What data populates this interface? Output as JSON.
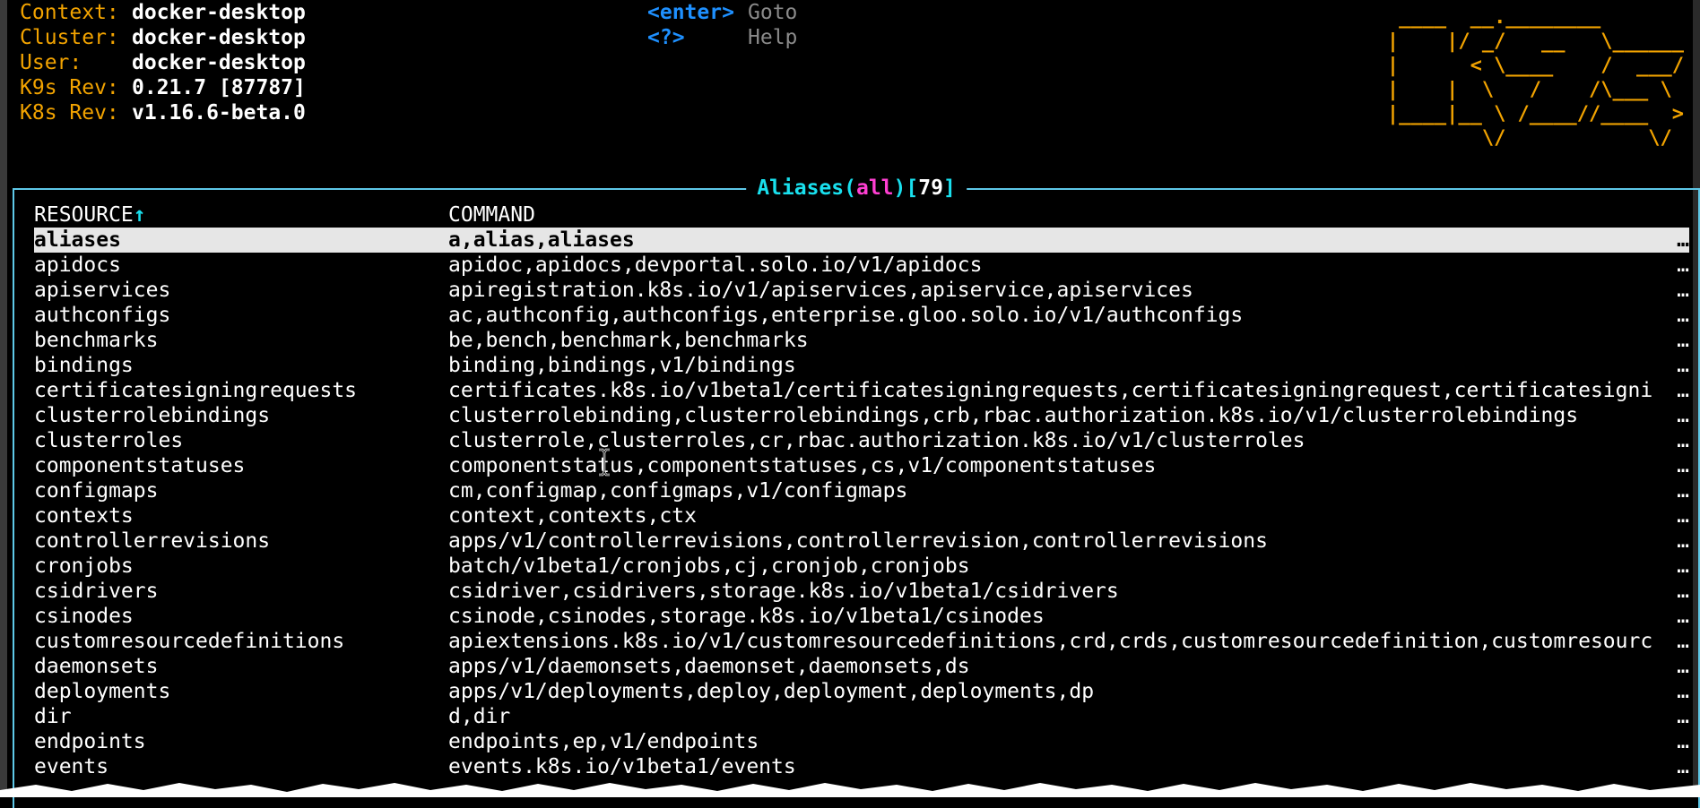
{
  "cluster_info": [
    {
      "label": "Context:",
      "value": "docker-desktop"
    },
    {
      "label": "Cluster:",
      "value": "docker-desktop"
    },
    {
      "label": "User:",
      "value": "docker-desktop"
    },
    {
      "label": "K9s Rev:",
      "value": "0.21.7 [87787]"
    },
    {
      "label": "K8s Rev:",
      "value": "v1.16.6-beta.0"
    }
  ],
  "key_hints": [
    {
      "key": "<enter>",
      "action": "Goto"
    },
    {
      "key": "<?>",
      "action": "Help"
    }
  ],
  "logo_ascii": " ____  __.________\n|    |/ _/   __   \\______\n|      < \\____    /  ___/\n|    |  \\   /    /\\___ \\\n|____|__ \\ /____//____  >\n        \\/            \\/",
  "view": {
    "title": "Aliases",
    "open_paren": "(",
    "namespace": "all",
    "close_paren": ")",
    "open_bracket": "[",
    "count": "79",
    "close_bracket": "]"
  },
  "table": {
    "columns": [
      "RESOURCE",
      "COMMAND"
    ],
    "sort_indicator": "↑",
    "ellipsis": "…",
    "rows": [
      {
        "resource": "aliases",
        "command": "a,alias,aliases"
      },
      {
        "resource": "apidocs",
        "command": "apidoc,apidocs,devportal.solo.io/v1/apidocs"
      },
      {
        "resource": "apiservices",
        "command": "apiregistration.k8s.io/v1/apiservices,apiservice,apiservices"
      },
      {
        "resource": "authconfigs",
        "command": "ac,authconfig,authconfigs,enterprise.gloo.solo.io/v1/authconfigs"
      },
      {
        "resource": "benchmarks",
        "command": "be,bench,benchmark,benchmarks"
      },
      {
        "resource": "bindings",
        "command": "binding,bindings,v1/bindings"
      },
      {
        "resource": "certificatesigningrequests",
        "command": "certificates.k8s.io/v1beta1/certificatesigningrequests,certificatesigningrequest,certificatesigni"
      },
      {
        "resource": "clusterrolebindings",
        "command": "clusterrolebinding,clusterrolebindings,crb,rbac.authorization.k8s.io/v1/clusterrolebindings"
      },
      {
        "resource": "clusterroles",
        "command": "clusterrole,clusterroles,cr,rbac.authorization.k8s.io/v1/clusterroles"
      },
      {
        "resource": "componentstatuses",
        "command": "componentstatus,componentstatuses,cs,v1/componentstatuses"
      },
      {
        "resource": "configmaps",
        "command": "cm,configmap,configmaps,v1/configmaps"
      },
      {
        "resource": "contexts",
        "command": "context,contexts,ctx"
      },
      {
        "resource": "controllerrevisions",
        "command": "apps/v1/controllerrevisions,controllerrevision,controllerrevisions"
      },
      {
        "resource": "cronjobs",
        "command": "batch/v1beta1/cronjobs,cj,cronjob,cronjobs"
      },
      {
        "resource": "csidrivers",
        "command": "csidriver,csidrivers,storage.k8s.io/v1beta1/csidrivers"
      },
      {
        "resource": "csinodes",
        "command": "csinode,csinodes,storage.k8s.io/v1beta1/csinodes"
      },
      {
        "resource": "customresourcedefinitions",
        "command": "apiextensions.k8s.io/v1/customresourcedefinitions,crd,crds,customresourcedefinition,customresourc"
      },
      {
        "resource": "daemonsets",
        "command": "apps/v1/daemonsets,daemonset,daemonsets,ds"
      },
      {
        "resource": "deployments",
        "command": "apps/v1/deployments,deploy,deployment,deployments,dp"
      },
      {
        "resource": "dir",
        "command": "d,dir"
      },
      {
        "resource": "endpoints",
        "command": "endpoints,ep,v1/endpoints"
      },
      {
        "resource": "events",
        "command": "events.k8s.io/v1beta1/events"
      }
    ]
  },
  "colors": {
    "accent_orange": "#f2a300",
    "key_blue": "#1e90ff",
    "frame_cyan": "#5ec8e8",
    "namespace_magenta": "#ff3fd2",
    "selected_row_bg": "#e6e6e6"
  }
}
